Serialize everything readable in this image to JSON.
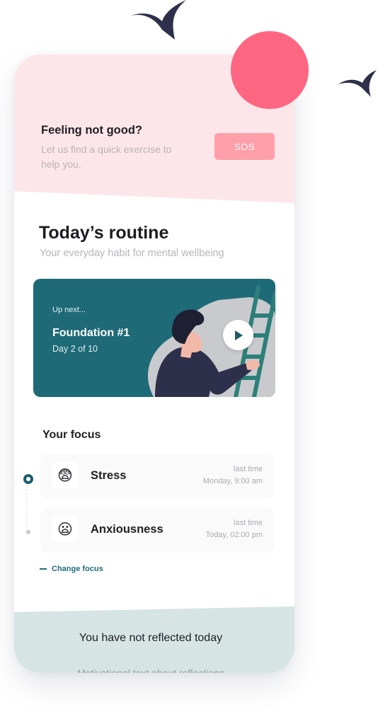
{
  "sos": {
    "title": "Feeling not good?",
    "subtitle": "Let us find a quick exercise to help you.",
    "button_label": "SOS"
  },
  "routine": {
    "title": "Today’s routine",
    "subtitle": "Your everyday habit for mental wellbeing"
  },
  "video_card": {
    "eyebrow": "Up next...",
    "title": "Foundation #1",
    "progress": "Day 2 of 10",
    "play_icon": "play-icon"
  },
  "focus": {
    "title": "Your focus",
    "items": [
      {
        "label": "Stress",
        "emoji": "😨",
        "meta_label": "last time",
        "meta_time": "Monday, 9:00 am",
        "active": true
      },
      {
        "label": "Anxiousness",
        "emoji": "😦",
        "meta_label": "last time",
        "meta_time": "Today, 02:00 pm",
        "active": false
      }
    ],
    "change_label": "Change focus"
  },
  "reflection": {
    "title": "You have not reflected today",
    "subtitle": "Motivational text about reflections"
  },
  "colors": {
    "accent_teal": "#1e6a77",
    "sos_pink": "#ff9fa9",
    "circle_pink": "#ff6682",
    "band_pink": "#fde6ea",
    "band_teal": "#d6e4e4"
  }
}
